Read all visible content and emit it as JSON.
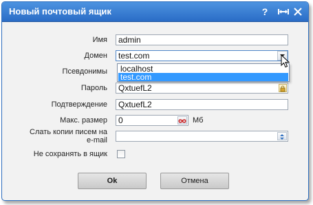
{
  "window": {
    "title": "Новый почтовый ящик"
  },
  "titlebar_icons": [
    "help-icon",
    "maximize-icon",
    "close-icon"
  ],
  "form": {
    "name": {
      "label": "Имя",
      "value": "admin"
    },
    "domain": {
      "label": "Домен",
      "value": "test.com",
      "options": [
        "localhost",
        "test.com"
      ],
      "selected": "test.com"
    },
    "aliases": {
      "label": "Псевдонимы"
    },
    "password": {
      "label": "Пароль",
      "value": "QxtuefL2"
    },
    "confirm": {
      "label": "Подтверждение",
      "value": "QxtuefL2"
    },
    "max_size": {
      "label": "Макс. размер",
      "value": "0",
      "unit": "Мб"
    },
    "copies": {
      "label_line1": "Слать копии писем на",
      "label_line2": "e-mail",
      "value": ""
    },
    "no_store": {
      "label": "Не сохранять в ящик",
      "checked": false
    }
  },
  "buttons": {
    "ok": "Ok",
    "cancel": "Отмена"
  },
  "colors": {
    "title_bar": "#2a6cc6",
    "selection": "#3399ff",
    "infinity": "#cc2222"
  }
}
